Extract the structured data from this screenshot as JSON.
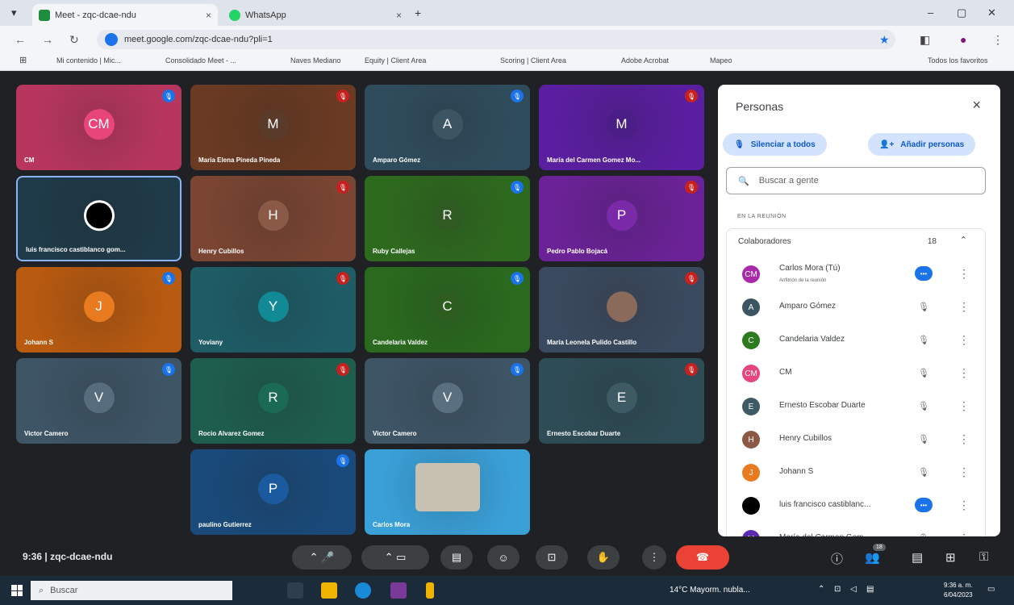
{
  "browser": {
    "tabs": [
      {
        "label": "Meet - zqc-dcae-ndu",
        "active": true
      },
      {
        "label": "WhatsApp",
        "active": false
      }
    ],
    "new_tab": "+",
    "url": "meet.google.com/zqc-dcae-ndu?pli=1",
    "bookmarks": [
      "Mi contenido | Mic...",
      "Consolidado Meet - ...",
      "Naves Mediano",
      "Equity | Client Area",
      "Scoring | Client Area",
      "Adobe Acrobat",
      "Mapeo",
      "Todos los favoritos"
    ]
  },
  "meet": {
    "time": "9:36",
    "separator": "|",
    "code": "zqc-dcae-ndu",
    "participants_badge": "18",
    "tiles": [
      {
        "initials": "CM",
        "name": "CM",
        "bg": "#b8365e",
        "av": "#e8457a"
      },
      {
        "initials": "M",
        "name": "Maria Elena Pineda Pineda",
        "bg": "#6a3a22",
        "av": "#5a3b2a"
      },
      {
        "initials": "A",
        "name": "Amparo Gómez",
        "bg": "#2f4c5c",
        "av": "#3b5563"
      },
      {
        "initials": "M",
        "name": "María del Carmen Gomez Mo...",
        "bg": "#5a1ea0",
        "av": "#4a1e86"
      },
      {
        "initials": "",
        "name": "luis francisco castiblanco gom...",
        "bg": "#1f3a48",
        "av": "#000"
      },
      {
        "initials": "H",
        "name": "Henry Cubillos",
        "bg": "#7a4532",
        "av": "#8a5a46"
      },
      {
        "initials": "R",
        "name": "Ruby Callejas",
        "bg": "#2e6a1e",
        "av": "#2f5a22"
      },
      {
        "initials": "P",
        "name": "Pedro Pablo Bojacá",
        "bg": "#6a2296",
        "av": "#7a2aa8"
      },
      {
        "initials": "J",
        "name": "Johann S",
        "bg": "#b85a10",
        "av": "#e87a20"
      },
      {
        "initials": "Y",
        "name": "Yoviany",
        "bg": "#1e5c66",
        "av": "#128a96"
      },
      {
        "initials": "C",
        "name": "Candelaria Valdez",
        "bg": "#2a6a1e",
        "av": "#2d5e20"
      },
      {
        "initials": "",
        "name": "María Leonela Pulido Castillo",
        "bg": "#3a4a5e",
        "av": "#8a6a5a"
      },
      {
        "initials": "V",
        "name": "Victor Camero",
        "bg": "#3e5566",
        "av": "#576d7d"
      },
      {
        "initials": "R",
        "name": "Rocio Alvarez Gomez",
        "bg": "#1e5e4e",
        "av": "#1a6a56"
      },
      {
        "initials": "V",
        "name": "Victor Camero",
        "bg": "#3e5566",
        "av": "#5a7080"
      },
      {
        "initials": "E",
        "name": "Ernesto Escobar Duarte",
        "bg": "#2e4c56",
        "av": "#3e5a64"
      },
      {
        "initials": "P",
        "name": "paulino Gutierrez",
        "bg": "#1a4a7a",
        "av": "#1b5a9e"
      },
      {
        "initials": "",
        "name": "Carlos Mora",
        "bg": "#3aa0d8",
        "av": "#c8c0b0"
      }
    ]
  },
  "panel": {
    "title": "Personas",
    "mute_all": "Silenciar a todos",
    "add_people": "Añadir personas",
    "search_placeholder": "Buscar a gente",
    "section_label": "EN LA REUNIÓN",
    "group_label": "Colaboradores",
    "group_count": "18",
    "people": [
      {
        "initials": "CM",
        "name": "Carlos Mora (Tú)",
        "sub": "Anfitrión de la reunión",
        "color": "#a82aa8",
        "speaking": true
      },
      {
        "initials": "A",
        "name": "Amparo Gómez",
        "sub": "",
        "color": "#3b5563",
        "speaking": false
      },
      {
        "initials": "C",
        "name": "Candelaria Valdez",
        "sub": "",
        "color": "#2d7a20",
        "speaking": false
      },
      {
        "initials": "CM",
        "name": "CM",
        "sub": "",
        "color": "#e8457a",
        "speaking": false
      },
      {
        "initials": "E",
        "name": "Ernesto Escobar Duarte",
        "sub": "",
        "color": "#3e5a64",
        "speaking": false
      },
      {
        "initials": "H",
        "name": "Henry Cubillos",
        "sub": "",
        "color": "#8a5a46",
        "speaking": false
      },
      {
        "initials": "J",
        "name": "Johann S",
        "sub": "",
        "color": "#e87a20",
        "speaking": false
      },
      {
        "initials": "",
        "name": "luis francisco castiblanc...",
        "sub": "",
        "color": "#000",
        "speaking": true
      },
      {
        "initials": "M",
        "name": "María del Carmen Gom...",
        "sub": "",
        "color": "#5a2ab0",
        "speaking": false
      }
    ]
  },
  "taskbar": {
    "search_placeholder": "Buscar",
    "weather": "14°C  Mayorm. nubla...",
    "time": "9:36 a. m.",
    "date": "6/04/2023"
  }
}
